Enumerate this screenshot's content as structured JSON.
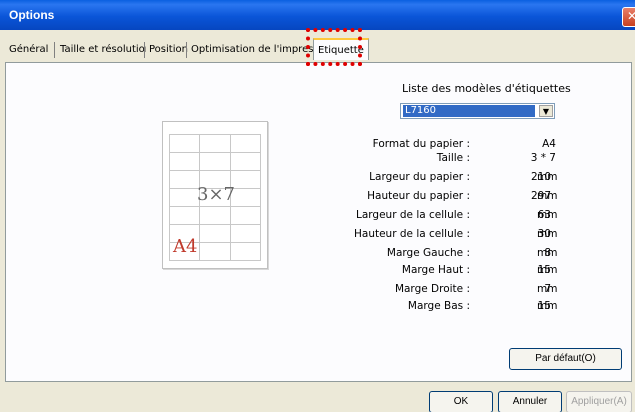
{
  "window": {
    "title": "Options",
    "close_label": "✕"
  },
  "tabs": [
    {
      "label": "Général"
    },
    {
      "label": "Taille et résolution"
    },
    {
      "label": "Position"
    },
    {
      "label": "Optimisation de l'impression"
    },
    {
      "label": "Etiquette",
      "active": true
    }
  ],
  "label_list": {
    "label": "Liste des modèles d'étiquettes",
    "selected": "L7160"
  },
  "preview": {
    "layout": "3×7",
    "format": "A4"
  },
  "properties": [
    {
      "label": "Format du papier :",
      "value": "A4",
      "unit": ""
    },
    {
      "label": "Taille :",
      "value": "3 * 7",
      "unit": ""
    },
    {
      "label": "Largeur du papier :",
      "value": "210",
      "unit": "mm"
    },
    {
      "label": "Hauteur du papier :",
      "value": "297",
      "unit": "mm"
    },
    {
      "label": "Largeur de la cellule :",
      "value": "63",
      "unit": "mm"
    },
    {
      "label": "Hauteur de la cellule :",
      "value": "30",
      "unit": "mm"
    },
    {
      "label": "Marge Gauche :",
      "value": "8",
      "unit": "mm"
    },
    {
      "label": "Marge Haut :",
      "value": "15",
      "unit": "mm"
    },
    {
      "label": "Marge Droite :",
      "value": "7",
      "unit": "mm"
    },
    {
      "label": "Marge Bas :",
      "value": "15",
      "unit": "mm"
    }
  ],
  "buttons": {
    "default": "Par défaut(O)",
    "ok": "OK",
    "cancel": "Annuler",
    "apply": "Appliquer(A)"
  },
  "colors": {
    "titlebar": "#0a55d8",
    "selection": "#316ac5",
    "highlight": "#e00000"
  }
}
